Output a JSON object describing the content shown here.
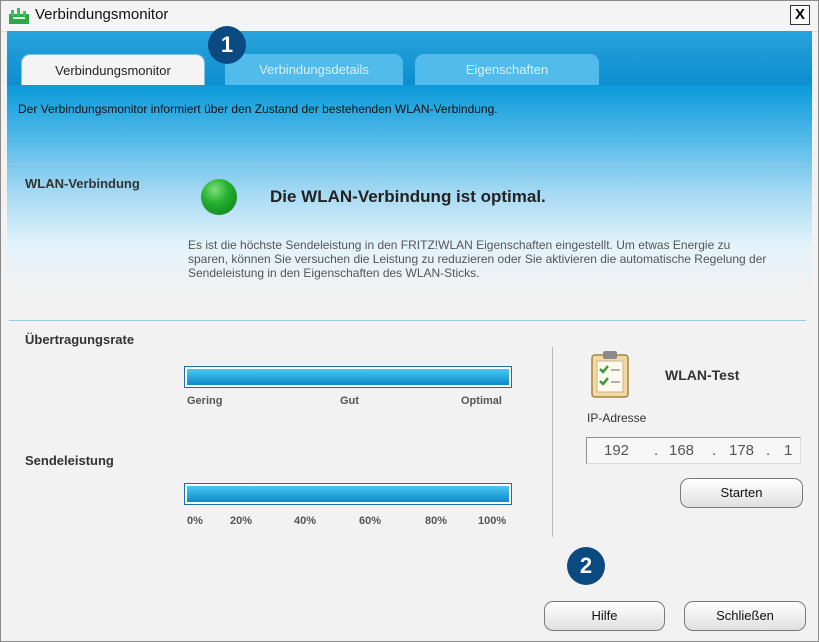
{
  "window": {
    "title": "Verbindungsmonitor",
    "close_label": "X"
  },
  "tabs": [
    {
      "label": "Verbindungsmonitor"
    },
    {
      "label": "Verbindungsdetails"
    },
    {
      "label": "Eigenschaften"
    }
  ],
  "callouts": [
    "1",
    "2"
  ],
  "info_text": "Der Verbindungsmonitor informiert über den Zustand der bestehenden WLAN-Verbindung.",
  "wlan": {
    "section_label": "WLAN-Verbindung",
    "status": "Die WLAN-Verbindung ist optimal.",
    "status_color": "#24b030",
    "description": "Es ist die höchste Sendeleistung in den FRITZ!WLAN Eigenschaften eingestellt. Um etwas Energie zu sparen, können Sie versuchen die Leistung zu reduzieren oder Sie aktivieren die automatische Regelung der Sendeleistung in den Eigenschaften des WLAN-Sticks."
  },
  "rate": {
    "label": "Übertragungsrate",
    "scale": [
      "Gering",
      "Gut",
      "Optimal"
    ],
    "level": 1.0
  },
  "power": {
    "label": "Sendeleistung",
    "scale": [
      "0%",
      "20%",
      "40%",
      "60%",
      "80%",
      "100%"
    ],
    "level": 1.0
  },
  "wlan_test": {
    "title": "WLAN-Test",
    "ip_label": "IP-Adresse",
    "ip_parts": [
      "192",
      "168",
      "178",
      "1"
    ],
    "separator": ".",
    "start_button": "Starten"
  },
  "footer": {
    "help_button": "Hilfe",
    "close_button": "Schließen"
  },
  "colors": {
    "accent": "#0d8ecf",
    "badge": "#0b4a80"
  }
}
